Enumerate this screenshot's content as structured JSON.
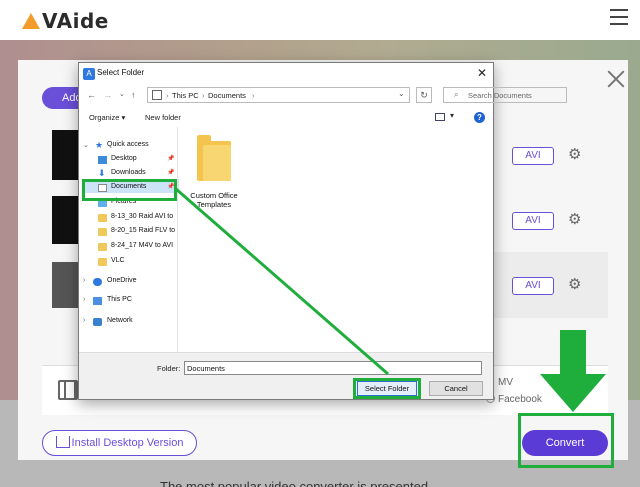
{
  "app": {
    "logo_text": "VAide",
    "add_button_label": "Add",
    "install_button_label": "Install Desktop Version",
    "convert_button_label": "Convert",
    "format_badges": [
      "AVI",
      "AVI",
      "AVI"
    ],
    "format_options_visible": [
      "MV",
      "Facebook"
    ],
    "bottom_text": "The most popular video converter is presented"
  },
  "dialog": {
    "title": "Select Folder",
    "close_symbol": "✕",
    "breadcrumb": [
      "This PC",
      "Documents"
    ],
    "search_placeholder": "Search Documents",
    "organize_label": "Organize ▾",
    "new_folder_label": "New folder",
    "help_label": "?",
    "nav_items": [
      {
        "label": "Quick access"
      },
      {
        "label": "Desktop"
      },
      {
        "label": "Downloads"
      },
      {
        "label": "Documents"
      },
      {
        "label": "Pictures"
      },
      {
        "label": "8-13_30 Raid AVI to"
      },
      {
        "label": "8-20_15 Raid FLV to"
      },
      {
        "label": "8-24_17 M4V to AVI"
      },
      {
        "label": "VLC"
      },
      {
        "label": "OneDrive"
      },
      {
        "label": "This PC"
      },
      {
        "label": "Network"
      }
    ],
    "folder_items": [
      {
        "label": "Custom Office Templates"
      }
    ],
    "folder_field_label": "Folder:",
    "folder_field_value": "Documents",
    "select_button_label": "Select Folder",
    "cancel_button_label": "Cancel"
  },
  "colors": {
    "accent_purple": "#6a4fd8",
    "annotation_green": "#1fae3c",
    "selection_blue": "#cde3f7"
  }
}
